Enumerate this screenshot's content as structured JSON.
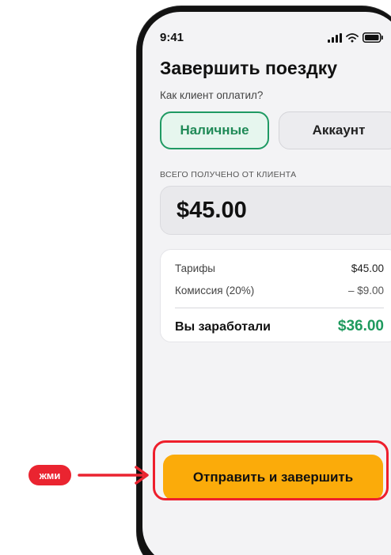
{
  "status_bar": {
    "time": "9:41",
    "icons": [
      "signal-icon",
      "wifi-icon",
      "battery-icon"
    ]
  },
  "page": {
    "title": "Завершить поездку",
    "payment_question": "Как клиент оплатил?",
    "payment_options": [
      {
        "label": "Наличные",
        "selected": true
      },
      {
        "label": "Аккаунт",
        "selected": false
      }
    ],
    "received_label": "ВСЕГО ПОЛУЧЕНО ОТ КЛИЕНТА",
    "received_amount": "$45.00"
  },
  "summary": {
    "rows": [
      {
        "label": "Тарифы",
        "value": "$45.00"
      },
      {
        "label": "Комиссия (20%)",
        "value": "– $9.00"
      }
    ],
    "earned_label": "Вы заработали",
    "earned_value": "$36.00"
  },
  "actions": {
    "submit_label": "Отправить и завершить"
  },
  "annotation": {
    "hint_label": "жми"
  },
  "colors": {
    "accent_green": "#1f9a5e",
    "submit_orange": "#fbab0a",
    "hint_red": "#ea2430"
  }
}
